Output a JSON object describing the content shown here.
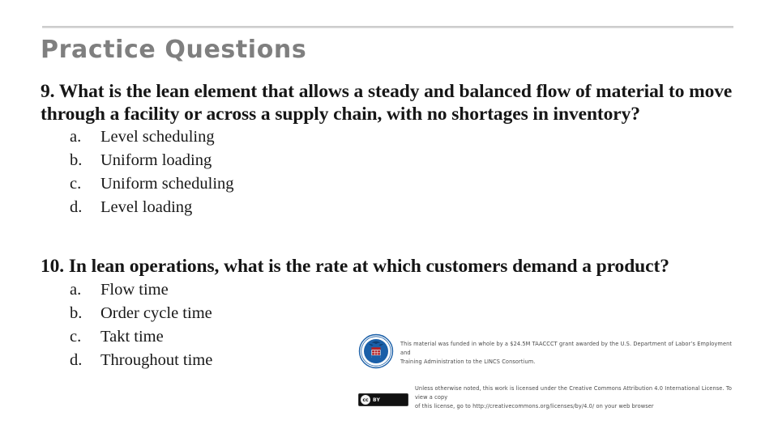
{
  "slide": {
    "title": "Practice Questions",
    "title_color": "#7f7f7f",
    "background_color": "#ffffff",
    "body_text_color": "#161616"
  },
  "questions": [
    {
      "number": "9.",
      "prompt": "9. What is the lean element that allows a steady and balanced flow of material to move through a facility or across a supply chain, with no shortages in inventory?",
      "options": [
        {
          "marker": "a.",
          "text": "Level scheduling"
        },
        {
          "marker": "b.",
          "text": "Uniform loading"
        },
        {
          "marker": "c.",
          "text": "Uniform scheduling"
        },
        {
          "marker": "d.",
          "text": "Level loading"
        }
      ]
    },
    {
      "number": "10.",
      "prompt": "10. In lean operations, what is the rate at which customers demand a product?",
      "options": [
        {
          "marker": "a.",
          "text": "Flow time"
        },
        {
          "marker": "b.",
          "text": "Order cycle time"
        },
        {
          "marker": "c.",
          "text": "Takt time"
        },
        {
          "marker": "d.",
          "text": "Throughout time"
        }
      ]
    }
  ],
  "footer": {
    "seal_icon": "dol-seal-icon",
    "seal_ring_color": "#1a5fa8",
    "seal_shield_color": "#b42126",
    "grant_line_1": "This material was funded in whole by a $24.5M TAACCCT grant awarded by the U.S. Department of Labor’s Employment and",
    "grant_line_2": "Training Administration to the LINCS Consortium.",
    "cc_badge": {
      "icon": "creative-commons-icon",
      "cc_mark": "cc",
      "by_mark": "BY"
    },
    "license_line_1": "Unless otherwise noted, this work is licensed under the Creative Commons Attribution 4.0 International License. To view a copy",
    "license_line_2": "of this license, go to http://creativecommons.org/licenses/by/4.0/ on your web browser"
  }
}
